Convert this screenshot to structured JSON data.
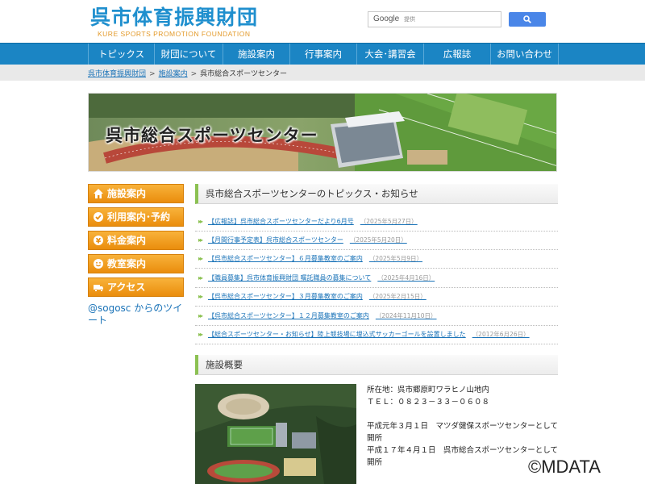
{
  "header": {
    "logo_text": "呉市体育振興財団",
    "logo_subtitle": "KURE SPORTS PROMOTION FOUNDATION",
    "search_brand": "Google",
    "search_placeholder": "提供"
  },
  "nav": {
    "items": [
      {
        "label": "トピックス"
      },
      {
        "label": "財団について"
      },
      {
        "label": "施設案内"
      },
      {
        "label": "行事案内"
      },
      {
        "label": "大会･講習会"
      },
      {
        "label": "広報誌"
      },
      {
        "label": "お問い合わせ"
      }
    ]
  },
  "breadcrumb": {
    "home": "呉市体育振興財団",
    "section": "施設案内",
    "separator": ">",
    "current": "呉市総合スポーツセンター"
  },
  "banner": {
    "title": "呉市総合スポーツセンター"
  },
  "sidebar": {
    "items": [
      {
        "label": "施設案内",
        "icon": "home-icon"
      },
      {
        "label": "利用案内･予約",
        "icon": "check-circle-icon"
      },
      {
        "label": "料金案内",
        "icon": "yen-icon"
      },
      {
        "label": "教室案内",
        "icon": "smiley-icon"
      },
      {
        "label": "アクセス",
        "icon": "truck-icon"
      }
    ],
    "twitter_link": "@sogosc からのツイート"
  },
  "topics": {
    "heading": "呉市総合スポーツセンターのトピックス・お知らせ",
    "items": [
      {
        "text": "【広報誌】呉市総合スポーツセンターだより6月号",
        "date": "（2025年5月27日）"
      },
      {
        "text": "【月間行事予定表】呉市総合スポーツセンター",
        "date": "（2025年5月20日）"
      },
      {
        "text": "【呉市総合スポーツセンター】６月募集教室のご案内",
        "date": "（2025年5月9日）"
      },
      {
        "text": "【職員募集】呉市体育振興財団 嘱託職員の募集について",
        "date": "（2025年4月16日）"
      },
      {
        "text": "【呉市総合スポーツセンター】３月募集教室のご案内",
        "date": "（2025年2月15日）"
      },
      {
        "text": "【呉市総合スポーツセンター】１２月募集教室のご案内",
        "date": "（2024年11月10日）"
      },
      {
        "text": "【総合スポーツセンター・お知らせ】陸上競技場に埋込式サッカーゴールを設置しました",
        "date": "（2012年6月26日）"
      }
    ]
  },
  "overview": {
    "heading": "施設概要",
    "address": "所在地：呉市郷原町ワラヒノ山地内",
    "tel": "ＴＥＬ：０８２３－３３－０６０８",
    "history_1": "平成元年３月１日　マツダ健保スポーツセンターとして開所",
    "history_2": "平成１７年４月１日　呉市総合スポーツセンターとして開所"
  },
  "watermark": "©MDATA",
  "colors": {
    "nav_blue": "#1b85c4",
    "logo_blue": "#1f8fce",
    "side_orange": "#f0a020",
    "accent_green": "#8cc152",
    "link_blue": "#1a73b8"
  }
}
